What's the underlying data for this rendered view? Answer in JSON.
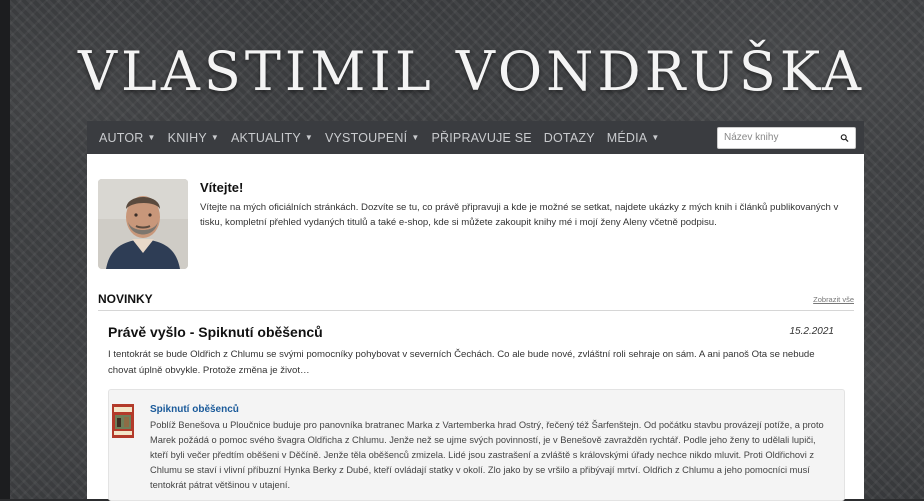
{
  "site": {
    "title": "VLASTIMIL VONDRUŠKA"
  },
  "nav": {
    "items": [
      {
        "label": "AUTOR",
        "dropdown": true
      },
      {
        "label": "KNIHY",
        "dropdown": true
      },
      {
        "label": "AKTUALITY",
        "dropdown": true
      },
      {
        "label": "VYSTOUPENÍ",
        "dropdown": true
      },
      {
        "label": "PŘIPRAVUJE SE",
        "dropdown": false
      },
      {
        "label": "DOTAZY",
        "dropdown": false
      },
      {
        "label": "MÉDIA",
        "dropdown": true
      }
    ],
    "caret": "▼",
    "search_placeholder": "Název knihy"
  },
  "welcome": {
    "title": "Vítejte!",
    "text": "Vítejte na mých oficiálních stránkách. Dozvíte se tu, co právě připravuji a kde je možné se setkat, najdete ukázky z mých knih i článků publikovaných v tisku, kompletní přehled vydaných titulů a také e-shop, kde si můžete zakoupit knihy mé i mojí ženy Aleny včetně podpisu."
  },
  "news": {
    "heading": "NOVINKY",
    "show_all": "Zobrazit vše"
  },
  "article": {
    "title": "Právě vyšlo - Spiknutí oběšenců",
    "date": "15.2.2021",
    "text": "I tentokrát se bude Oldřich z Chlumu se svými pomocníky pohybovat v severních Čechách. Co ale bude nové, zvláštní roli sehraje on sám. A ani panoš Ota se nebude chovat úplně obvykle. Protože změna je život…"
  },
  "book": {
    "title": "Spiknutí oběšenců",
    "text": "Poblíž Benešova u Ploučnice buduje pro panovníka bratranec Marka z Vartemberka hrad Ostrý, řečený též Šarfenštejn. Od počátku stavbu provázejí potíže, a proto Marek požádá o pomoc svého švagra Oldřicha z Chlumu. Jenže než se ujme svých povinností, je v Benešově zavražděn rychtář. Podle jeho ženy to udělali lupiči, kteří byli večer předtím oběšeni v Děčíně. Jenže těla oběšenců zmizela. Lidé jsou zastrašení a zvláště s královskými úřady nechce nikdo mluvit. Proti Oldřichovi z Chlumu se staví i vlivní příbuzní Hynka Berky z Dubé, kteří ovládají statky v okolí. Zlo jako by se vršilo a přibývají mrtví. Oldřich z Chlumu a jeho pomocníci musí tentokrát pátrat většinou v utajení."
  },
  "colors": {
    "navbar": "#3a3c40",
    "nav_text": "#c9cbce",
    "link": "#1a5a9a",
    "card_bg": "#f4f4f4"
  },
  "icons": {
    "search": "search-icon",
    "avatar": "author-photo"
  }
}
